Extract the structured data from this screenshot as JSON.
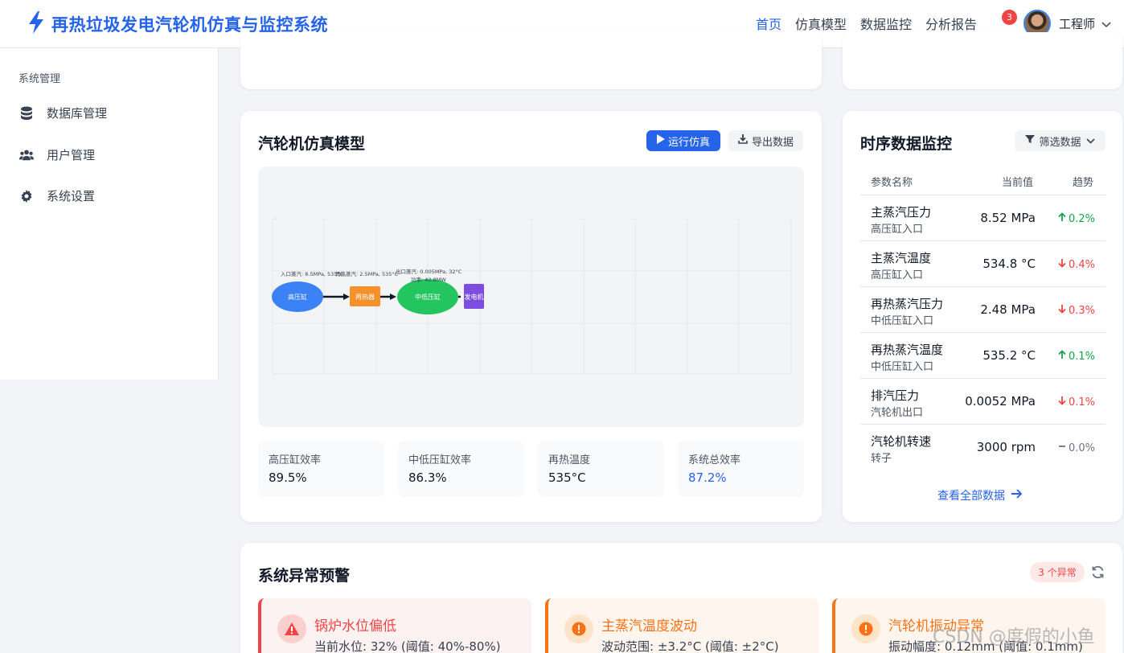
{
  "app": {
    "title": "再热垃圾发电汽轮机仿真与监控系统"
  },
  "nav": {
    "items": [
      "首页",
      "仿真模型",
      "数据监控",
      "分析报告"
    ]
  },
  "notifications": {
    "count": "3"
  },
  "user": {
    "name": "工程师"
  },
  "sidebar": {
    "section": "系统管理",
    "items": [
      {
        "label": "数据库管理",
        "icon": "database-icon"
      },
      {
        "label": "用户管理",
        "icon": "users-icon"
      },
      {
        "label": "系统设置",
        "icon": "gear-icon"
      }
    ]
  },
  "simulation": {
    "title": "汽轮机仿真模型",
    "run_label": "运行仿真",
    "export_label": "导出数据",
    "diagram": {
      "hp_label": "高压缸",
      "reheater_label": "再热器",
      "ilp_label": "中低压缸",
      "gen_label": "发电机",
      "inlet_text": "入口蒸汽: 8.5MPa, 535°C",
      "reheat_text": "再热蒸汽: 2.5MPa, 535°C",
      "outlet_text": "出口蒸汽: 0.005MPa, 32°C",
      "power_text": "功率: 42.8MW"
    },
    "metrics": [
      {
        "label": "高压缸效率",
        "value": "89.5%"
      },
      {
        "label": "中低压缸效率",
        "value": "86.3%"
      },
      {
        "label": "再热温度",
        "value": "535°C"
      },
      {
        "label": "系统总效率",
        "value": "87.2%"
      }
    ]
  },
  "monitor": {
    "title": "时序数据监控",
    "filter_label": "筛选数据",
    "columns": [
      "参数名称",
      "当前值",
      "趋势"
    ],
    "rows": [
      {
        "name": "主蒸汽压力",
        "sub": "高压缸入口",
        "value": "8.52 MPa",
        "trend": "0.2%",
        "dir": "up"
      },
      {
        "name": "主蒸汽温度",
        "sub": "高压缸入口",
        "value": "534.8 °C",
        "trend": "0.4%",
        "dir": "down"
      },
      {
        "name": "再热蒸汽压力",
        "sub": "中低压缸入口",
        "value": "2.48 MPa",
        "trend": "0.3%",
        "dir": "down"
      },
      {
        "name": "再热蒸汽温度",
        "sub": "中低压缸入口",
        "value": "535.2 °C",
        "trend": "0.1%",
        "dir": "up"
      },
      {
        "name": "排汽压力",
        "sub": "汽轮机出口",
        "value": "0.0052 MPa",
        "trend": "0.1%",
        "dir": "down"
      },
      {
        "name": "汽轮机转速",
        "sub": "转子",
        "value": "3000 rpm",
        "trend": "0.0%",
        "dir": "flat"
      }
    ],
    "view_all_label": "查看全部数据"
  },
  "alerts": {
    "title": "系统异常预警",
    "count_label": "3 个异常",
    "items": [
      {
        "title": "锅炉水位偏低",
        "desc": "当前水位: 32% (阈值: 40%-80%)",
        "level": "danger"
      },
      {
        "title": "主蒸汽温度波动",
        "desc": "波动范围: ±3.2°C (阈值: ±2°C)",
        "level": "warning"
      },
      {
        "title": "汽轮机振动异常",
        "desc": "振动幅度: 0.12mm (阈值: 0.1mm)",
        "level": "warning"
      }
    ]
  },
  "watermark": "CSDN @度假的小鱼",
  "colors": {
    "accent": "#2563eb",
    "up": "#16a34a",
    "down": "#ef4444",
    "danger": "#ef4444",
    "warning": "#f97316"
  }
}
